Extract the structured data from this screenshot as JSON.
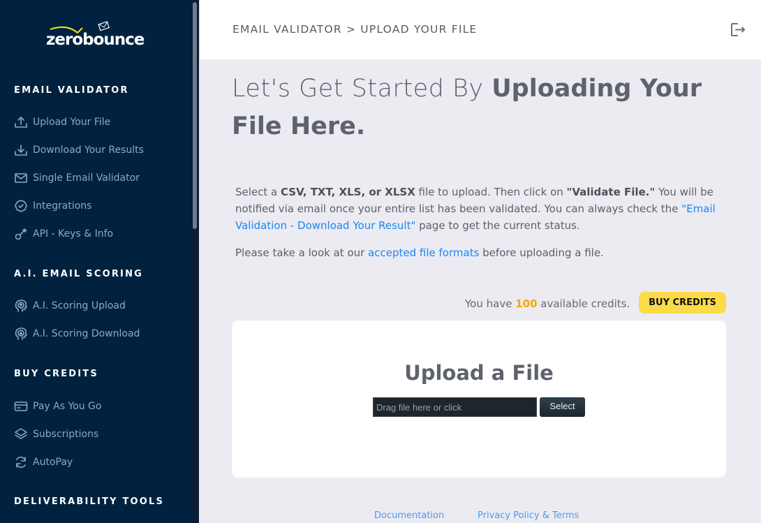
{
  "brand": {
    "name": "zerobounce",
    "accent": "#fbdb48"
  },
  "sidebar": {
    "sections": [
      {
        "title": "EMAIL VALIDATOR",
        "items": [
          {
            "label": "Upload Your File",
            "icon": "upload-icon"
          },
          {
            "label": "Download Your Results",
            "icon": "download-icon"
          },
          {
            "label": "Single Email Validator",
            "icon": "envelope-icon"
          },
          {
            "label": "Integrations",
            "icon": "badge-check-icon"
          },
          {
            "label": "API - Keys & Info",
            "icon": "key-icon"
          }
        ]
      },
      {
        "title": "A.I. EMAIL SCORING",
        "items": [
          {
            "label": "A.I. Scoring Upload",
            "icon": "head-upload-icon"
          },
          {
            "label": "A.I. Scoring Download",
            "icon": "head-download-icon"
          }
        ]
      },
      {
        "title": "BUY CREDITS",
        "items": [
          {
            "label": "Pay As You Go",
            "icon": "credit-card-icon"
          },
          {
            "label": "Subscriptions",
            "icon": "layers-icon"
          },
          {
            "label": "AutoPay",
            "icon": "refresh-icon"
          }
        ]
      },
      {
        "title": "DELIVERABILITY TOOLS",
        "items": []
      }
    ]
  },
  "topbar": {
    "breadcrumb": "EMAIL VALIDATOR > UPLOAD YOUR FILE",
    "logout_icon": "logout-icon"
  },
  "hero": {
    "light": "Let's Get Started By ",
    "bold": "Uploading Your File Here."
  },
  "instructions": {
    "p1_a": "Select a ",
    "p1_formats": "CSV, TXT, XLS, or XLSX",
    "p1_b": " file to upload. Then click on ",
    "p1_validate": "\"Validate File.\"",
    "p1_c": " You will be notified via email once your entire list has been validated. You can always check the ",
    "p1_link": "\"Email Validation - Download Your Result\"",
    "p1_d": " page to get the current status.",
    "p2_a": "Please take a look at our ",
    "p2_link": "accepted file formats",
    "p2_b": " before uploading a file."
  },
  "credits": {
    "prefix": "You have ",
    "count": "100",
    "suffix": " available credits.",
    "buy_label": "BUY CREDITS"
  },
  "upload": {
    "title": "Upload a File",
    "placeholder": "Drag file here or click",
    "select_label": "Select"
  },
  "footer": {
    "links": [
      "Documentation",
      "Privacy Policy & Terms"
    ]
  }
}
